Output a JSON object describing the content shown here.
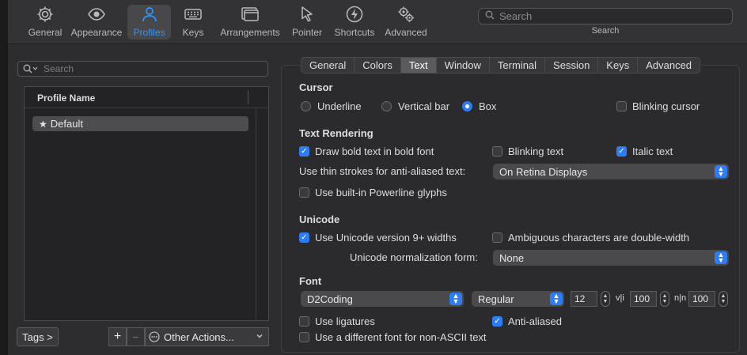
{
  "toolbar": {
    "items": [
      {
        "label": "General",
        "icon": "gear-icon"
      },
      {
        "label": "Appearance",
        "icon": "eye-icon"
      },
      {
        "label": "Profiles",
        "icon": "person-icon",
        "active": true
      },
      {
        "label": "Keys",
        "icon": "keyboard-icon"
      },
      {
        "label": "Arrangements",
        "icon": "windows-icon"
      },
      {
        "label": "Pointer",
        "icon": "cursor-icon"
      },
      {
        "label": "Shortcuts",
        "icon": "lightning-icon"
      },
      {
        "label": "Advanced",
        "icon": "gears-icon"
      }
    ],
    "search_placeholder": "Search",
    "search_caption": "Search"
  },
  "profiles": {
    "search_placeholder": "Search",
    "column_header": "Profile Name",
    "items": [
      {
        "name": "Default",
        "star": "★"
      }
    ],
    "tags_label": "Tags >",
    "add_label": "+",
    "remove_label": "−",
    "other_actions_label": "Other Actions...",
    "chevron": "⌄"
  },
  "tabs": [
    "General",
    "Colors",
    "Text",
    "Window",
    "Terminal",
    "Session",
    "Keys",
    "Advanced"
  ],
  "active_tab": "Text",
  "cursor": {
    "title": "Cursor",
    "options": [
      "Underline",
      "Vertical bar",
      "Box"
    ],
    "selected": "Box",
    "blinking_label": "Blinking cursor",
    "blinking": false
  },
  "text_rendering": {
    "title": "Text Rendering",
    "bold_label": "Draw bold text in bold font",
    "bold": true,
    "blinking_text_label": "Blinking text",
    "blinking_text": false,
    "italic_label": "Italic text",
    "italic": true,
    "thin_strokes_label": "Use thin strokes for anti-aliased text:",
    "thin_strokes_value": "On Retina Displays",
    "powerline_label": "Use built-in Powerline glyphs",
    "powerline": false
  },
  "unicode": {
    "title": "Unicode",
    "v9_label": "Use Unicode version 9+ widths",
    "v9": true,
    "ambiguous_label": "Ambiguous characters are double-width",
    "ambiguous": false,
    "normalization_label": "Unicode normalization form:",
    "normalization_value": "None"
  },
  "font": {
    "title": "Font",
    "family": "D2Coding",
    "style": "Regular",
    "size": "12",
    "vertical_spacing_icon": "v|i",
    "vertical_spacing": "100",
    "horizontal_spacing_icon": "n|n",
    "horizontal_spacing": "100",
    "ligatures_label": "Use ligatures",
    "ligatures": false,
    "antialiased_label": "Anti-aliased",
    "antialiased": true,
    "non_ascii_label": "Use a different font for non-ASCII text",
    "non_ascii": false
  },
  "colors": {
    "accent": "#2d7df6",
    "active_toolbar": "#2f97ff",
    "background": "#2d2d2f"
  },
  "glyphs": {
    "check": "✓",
    "up": "▲",
    "down": "▼",
    "search": "⌕",
    "ellipsis": "⋯"
  }
}
